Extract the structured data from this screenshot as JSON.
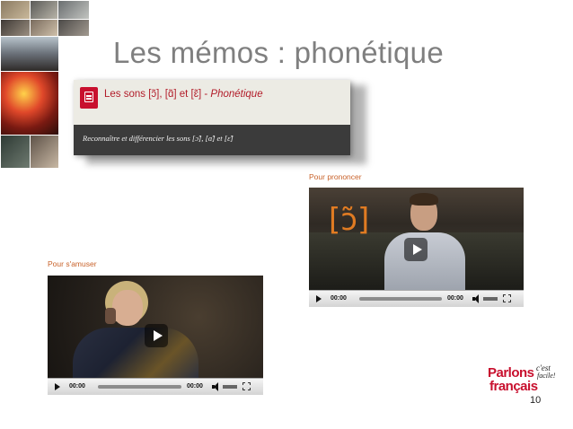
{
  "slide": {
    "title": "Les mémos : phonétique",
    "page_number": "10"
  },
  "card": {
    "title_main": "Les sons [ɔ̃], [ɑ̃] et [ɛ̃] - ",
    "title_em": "Phonétique",
    "subtitle": "Reconnaître et différencier les sons [ɔ̃], [ɑ̃] et [ɛ̃]",
    "icon": "document-icon",
    "accent_color": "#b21d2a"
  },
  "videos": {
    "prononcer": {
      "label": "Pour prononcer",
      "overlay_symbol": "[ɔ̃]",
      "time_elapsed": "00:00",
      "time_total": "00:00"
    },
    "amuser": {
      "label": "Pour s'amuser",
      "time_elapsed": "00:00",
      "time_total": "00:00"
    }
  },
  "logo": {
    "line1": "Parlons",
    "line2": "français",
    "line3": "c'est",
    "line4": "facile!"
  },
  "colors": {
    "title_gray": "#7f7f7f",
    "label_orange": "#c8622a",
    "brand_red": "#c8102e"
  }
}
